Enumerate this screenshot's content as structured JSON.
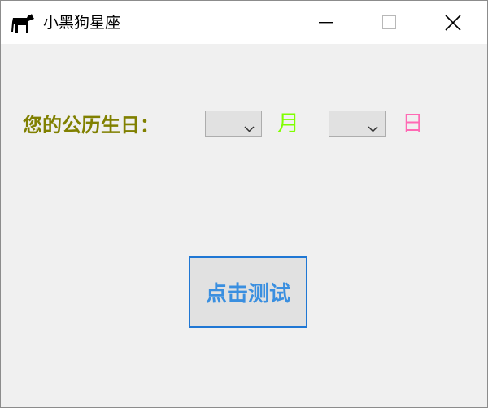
{
  "window": {
    "title": "小黑狗星座",
    "app_icon": "black-dog-icon",
    "controls": {
      "minimize_icon": "minimize-icon",
      "maximize_icon": "maximize-icon",
      "close_icon": "close-icon"
    }
  },
  "form": {
    "birthday_label": "您的公历生日：",
    "month_select": {
      "value": "",
      "unit_label": "月",
      "unit_color": "#7fff00"
    },
    "day_select": {
      "value": "",
      "unit_label": "日",
      "unit_color": "#ff69b4"
    },
    "label_color": "#808000"
  },
  "actions": {
    "test_button_label": "点击测试",
    "test_button_color": "#3a8fe0",
    "test_button_border": "#1f77d4"
  }
}
